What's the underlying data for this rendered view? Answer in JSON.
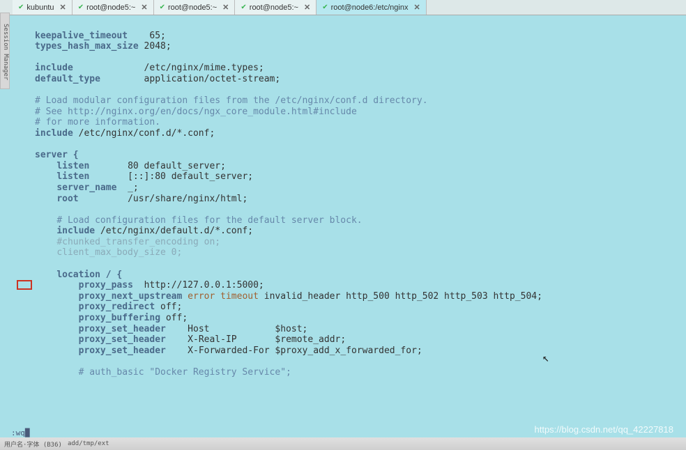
{
  "sidebar": {
    "label": "Session Manager"
  },
  "tabs": [
    {
      "label": "kubuntu",
      "active": false
    },
    {
      "label": "root@node5:~",
      "active": false
    },
    {
      "label": "root@node5:~",
      "active": false
    },
    {
      "label": "root@node5:~",
      "active": false
    },
    {
      "label": "root@node6:/etc/nginx",
      "active": true
    }
  ],
  "code": {
    "l1a": "keepalive_timeout",
    "l1b": "65;",
    "l2a": "types_hash_max_size",
    "l2b": "2048;",
    "l3a": "include",
    "l3b": "/etc/nginx/mime.types;",
    "l4a": "default_type",
    "l4b": "application/octet-stream;",
    "c1": "# Load modular configuration files from the /etc/nginx/conf.d directory.",
    "c2": "# See http://nginx.org/en/docs/ngx_core_module.html#include",
    "c3": "# for more information.",
    "inc1": "include",
    "inc1v": "/etc/nginx/conf.d/*.conf;",
    "server": "server {",
    "listen1a": "listen",
    "listen1b": "80 default_server;",
    "listen2a": "listen",
    "listen2b": "[::]:80 default_server;",
    "sn_a": "server_name",
    "sn_b": "_;",
    "root_a": "root",
    "root_b": "/usr/share/nginx/html;",
    "c4": "# Load configuration files for the default server block.",
    "inc2": "include",
    "inc2v": "/etc/nginx/default.d/*.conf;",
    "cte": "#chunked_transfer_encoding on;",
    "cmbs": "client_max_body_size 0;",
    "loc": "location / {",
    "pp_a": "proxy_pass",
    "pp_b": "http://127.0.0.1:5000;",
    "pnu_a": "proxy_next_upstream",
    "pnu_b1": "error",
    "pnu_b2": "timeout",
    "pnu_b3": "invalid_header http_500 http_502 http_503 http_504;",
    "pr_a": "proxy_redirect",
    "pr_b": "off;",
    "pb_a": "proxy_buffering",
    "pb_b": "off;",
    "psh1_a": "proxy_set_header",
    "psh1_b": "Host",
    "psh1_c": "$host;",
    "psh2_a": "proxy_set_header",
    "psh2_b": "X-Real-IP",
    "psh2_c": "$remote_addr;",
    "psh3_a": "proxy_set_header",
    "psh3_b": "X-Forwarded-For",
    "psh3_c": "$proxy_add_x_forwarded_for;",
    "c5a": "# auth_basic \"Docker Registry Service\";"
  },
  "status": ":wq",
  "taskbar": {
    "item1": "用户名·字体 (B36)",
    "item2": "add/tmp/ext"
  },
  "watermark": "https://blog.csdn.net/qq_42227818",
  "icons": {
    "check": "✔",
    "close": "✕"
  }
}
